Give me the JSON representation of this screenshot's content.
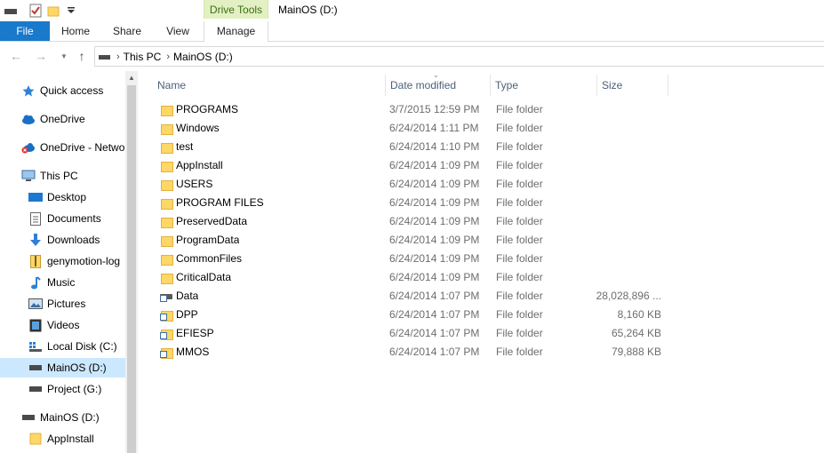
{
  "title_bar": {
    "context_tab": "Drive Tools",
    "window_title": "MainOS (D:)"
  },
  "ribbon": {
    "tabs": [
      "File",
      "Home",
      "Share",
      "View",
      "Manage"
    ]
  },
  "address": {
    "crumbs": [
      "This PC",
      "MainOS (D:)"
    ]
  },
  "nav": {
    "items": [
      {
        "label": "Quick access",
        "icon": "star-icon"
      },
      {
        "label": "OneDrive",
        "icon": "cloud-icon"
      },
      {
        "label": "OneDrive - Netwo",
        "icon": "cloud-error-icon"
      },
      {
        "label": "This PC",
        "icon": "computer-icon"
      },
      {
        "label": "Desktop",
        "icon": "desktop-icon"
      },
      {
        "label": "Documents",
        "icon": "documents-icon"
      },
      {
        "label": "Downloads",
        "icon": "download-icon"
      },
      {
        "label": "genymotion-log",
        "icon": "zip-icon"
      },
      {
        "label": "Music",
        "icon": "music-icon"
      },
      {
        "label": "Pictures",
        "icon": "pictures-icon"
      },
      {
        "label": "Videos",
        "icon": "videos-icon"
      },
      {
        "label": "Local Disk (C:)",
        "icon": "windows-drive-icon"
      },
      {
        "label": "MainOS (D:)",
        "icon": "drive-icon"
      },
      {
        "label": "Project (G:)",
        "icon": "drive-icon"
      },
      {
        "label": "MainOS (D:)",
        "icon": "drive-icon"
      },
      {
        "label": "AppInstall",
        "icon": "folder-icon"
      }
    ]
  },
  "columns": {
    "name": "Name",
    "date": "Date modified",
    "type": "Type",
    "size": "Size"
  },
  "files": [
    {
      "name": "PROGRAMS",
      "date": "3/7/2015 12:59 PM",
      "type": "File folder",
      "size": "",
      "icon": "folder"
    },
    {
      "name": "Windows",
      "date": "6/24/2014 1:11 PM",
      "type": "File folder",
      "size": "",
      "icon": "folder"
    },
    {
      "name": "test",
      "date": "6/24/2014 1:10 PM",
      "type": "File folder",
      "size": "",
      "icon": "folder"
    },
    {
      "name": "AppInstall",
      "date": "6/24/2014 1:09 PM",
      "type": "File folder",
      "size": "",
      "icon": "folder"
    },
    {
      "name": "USERS",
      "date": "6/24/2014 1:09 PM",
      "type": "File folder",
      "size": "",
      "icon": "folder"
    },
    {
      "name": "PROGRAM FILES",
      "date": "6/24/2014 1:09 PM",
      "type": "File folder",
      "size": "",
      "icon": "folder"
    },
    {
      "name": "PreservedData",
      "date": "6/24/2014 1:09 PM",
      "type": "File folder",
      "size": "",
      "icon": "folder"
    },
    {
      "name": "ProgramData",
      "date": "6/24/2014 1:09 PM",
      "type": "File folder",
      "size": "",
      "icon": "folder"
    },
    {
      "name": "CommonFiles",
      "date": "6/24/2014 1:09 PM",
      "type": "File folder",
      "size": "",
      "icon": "folder"
    },
    {
      "name": "CriticalData",
      "date": "6/24/2014 1:09 PM",
      "type": "File folder",
      "size": "",
      "icon": "folder"
    },
    {
      "name": "Data",
      "date": "6/24/2014 1:07 PM",
      "type": "File folder",
      "size": "28,028,896 ...",
      "icon": "drive-shortcut"
    },
    {
      "name": "DPP",
      "date": "6/24/2014 1:07 PM",
      "type": "File folder",
      "size": "8,160 KB",
      "icon": "folder-shortcut"
    },
    {
      "name": "EFIESP",
      "date": "6/24/2014 1:07 PM",
      "type": "File folder",
      "size": "65,264 KB",
      "icon": "folder-shortcut"
    },
    {
      "name": "MMOS",
      "date": "6/24/2014 1:07 PM",
      "type": "File folder",
      "size": "79,888 KB",
      "icon": "folder-shortcut"
    }
  ],
  "colors": {
    "file_tab": "#1979ca",
    "context_tab_bg": "#e3f0c3",
    "selected_nav": "#cce8ff"
  }
}
